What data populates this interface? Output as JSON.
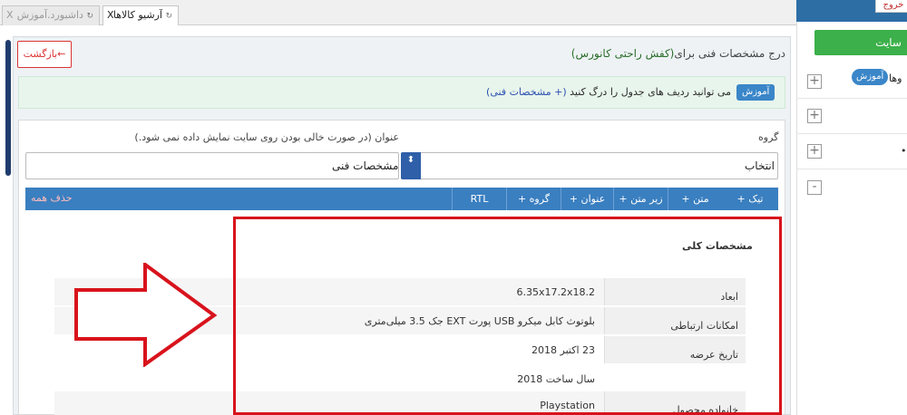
{
  "tabs": {
    "active": "آرشیو کالاها",
    "inactive": "داشبورد.آموزش",
    "close_glyph": "X"
  },
  "sidebar": {
    "logout": "خروج",
    "site_button": "سایت",
    "badge": "آموزش",
    "partial_label": "وها",
    "plus": "+",
    "minus": "-",
    "dot": "•"
  },
  "page": {
    "back_button": "بازگشت←",
    "heading_prefix": "درج مشخصات فنی برای",
    "heading_product": "(کفش راحتی کانورس)",
    "info_badge": "آموزش",
    "info_text_prefix": "می توانید ردیف های جدول را درگ کنید",
    "info_text_link": "(+ مشخصات فنی)"
  },
  "form": {
    "group_label": "گروه",
    "title_label": "عنوان (در صورت خالی بودن روی سایت نمایش داده نمی شود.)",
    "select_value": "انتخاب",
    "select_arrow": "⬍",
    "input_value": "مشخصات فنی"
  },
  "toolbar": {
    "buttons": [
      "+ تیک",
      "+ متن",
      "+ زیر متن",
      "+ عنوان",
      "+ گروه",
      "RTL"
    ],
    "delete_all": "حذف همه"
  },
  "specs": {
    "section_title": "مشخصات کلی",
    "rows": [
      {
        "key": "ابعاد",
        "value": "6.35x17.2x18.2"
      },
      {
        "key": "امکانات ارتباطی",
        "value": "بلوتوث کابل میکرو USB پورت EXT جک 3.5 میلی‌متری"
      },
      {
        "key": "تاریخ عرضه",
        "value": "23 اکتبر 2018"
      },
      {
        "key": "",
        "value": "سال ساخت 2018"
      },
      {
        "key": "خانواده محصول",
        "value": "Playstation"
      }
    ]
  },
  "colors": {
    "accent": "#3a7fc0",
    "highlight_box": "#d8131c",
    "arrow": "#d8131c"
  }
}
